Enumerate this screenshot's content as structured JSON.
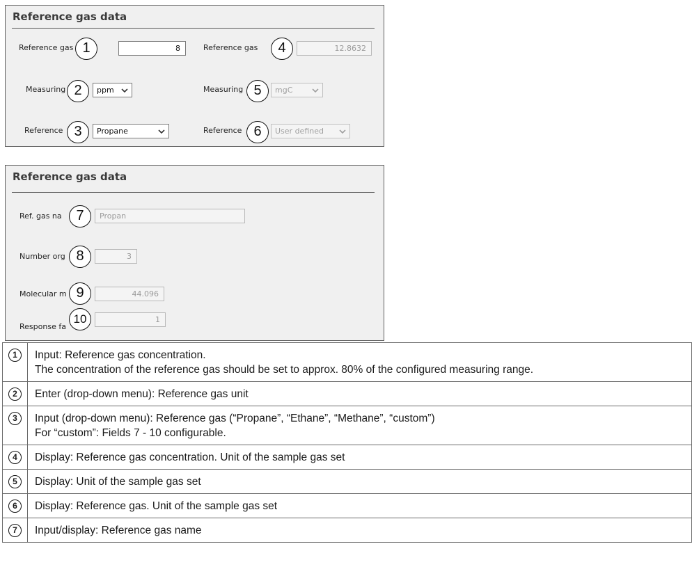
{
  "panel_top": {
    "title": "Reference gas data",
    "left": {
      "conc_label": "Reference gas",
      "conc_value": "8",
      "unit_label": "Measuring",
      "unit_value": "ppm",
      "gas_label": "Reference",
      "gas_value": "Propane"
    },
    "right": {
      "conc_label": "Reference gas",
      "conc_value": "12.8632",
      "unit_label": "Measuring",
      "unit_value": "mgC",
      "gas_label": "Reference",
      "gas_value": "User defined"
    }
  },
  "panel_bottom": {
    "title": "Reference gas data",
    "name_label": "Ref. gas na",
    "name_value": "Propan",
    "carbon_label": "Number org",
    "carbon_value": "3",
    "molar_label": "Molecular m",
    "molar_value": "44.096",
    "response_label": "Response fa",
    "response_value": "1"
  },
  "callouts": [
    "1",
    "2",
    "3",
    "4",
    "5",
    "6",
    "7",
    "8",
    "9",
    "10"
  ],
  "legend": [
    {
      "num": "1",
      "lines": [
        "Input: Reference gas concentration.",
        "The concentration of the reference gas should be set to approx. 80% of the configured measuring range."
      ]
    },
    {
      "num": "2",
      "lines": [
        "Enter (drop-down menu): Reference gas unit"
      ]
    },
    {
      "num": "3",
      "lines": [
        "Input (drop-down menu): Reference gas (“Propane”, “Ethane”, “Methane”, “custom”)",
        "For “custom”: Fields 7 - 10 configurable."
      ]
    },
    {
      "num": "4",
      "lines": [
        "Display: Reference gas concentration. Unit of the sample gas set"
      ]
    },
    {
      "num": "5",
      "lines": [
        "Display: Unit of the sample gas set"
      ]
    },
    {
      "num": "6",
      "lines": [
        "Display: Reference gas. Unit of the sample gas set"
      ]
    },
    {
      "num": "7",
      "lines": [
        "Input/display: Reference gas name"
      ]
    }
  ],
  "icons": {
    "dropdown": "chevron-down-icon"
  },
  "colors": {
    "panel_bg": "#f0f0f0",
    "border": "#606060",
    "disabled_text": "#9a9a9a"
  }
}
